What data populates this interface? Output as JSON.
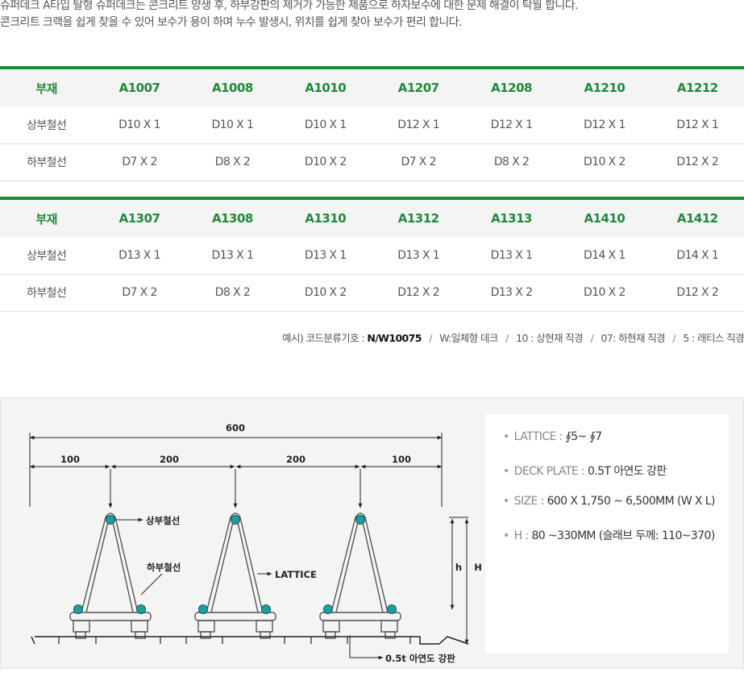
{
  "intro": {
    "line1": "슈퍼데크 A타입 탈형 슈퍼데크는 콘크리트 양생 후, 하부강판의 제거가 가능한 제품으로 하자보수에 대한 문제 해결이 탁월 합니다.",
    "line2": "콘크리트 크랙을 쉽게 찾을 수 있어 보수가 용이 하며 누수 발생시, 위치를 쉽게 찾아 보수가 편리 합니다."
  },
  "tables": [
    {
      "header": [
        "부재",
        "A1007",
        "A1008",
        "A1010",
        "A1207",
        "A1208",
        "A1210",
        "A1212"
      ],
      "rows": [
        [
          "상부철선",
          "D10 X 1",
          "D10 X 1",
          "D10 X 1",
          "D12 X 1",
          "D12 X 1",
          "D12 X 1",
          "D12 X 1"
        ],
        [
          "하부철선",
          "D7 X 2",
          "D8 X 2",
          "D10 X 2",
          "D7 X 2",
          "D8 X 2",
          "D10 X 2",
          "D12 X 2"
        ]
      ]
    },
    {
      "header": [
        "부재",
        "A1307",
        "A1308",
        "A1310",
        "A1312",
        "A1313",
        "A1410",
        "A1412"
      ],
      "rows": [
        [
          "상부철선",
          "D13 X 1",
          "D13 X 1",
          "D13 X 1",
          "D13 X 1",
          "D13 X 1",
          "D14 X 1",
          "D14 X 1"
        ],
        [
          "하부철선",
          "D7 X 2",
          "D8 X 2",
          "D10 X 2",
          "D12 X 2",
          "D13 X 2",
          "D10 X 2",
          "D12 X 2"
        ]
      ]
    }
  ],
  "code_note": {
    "prefix": "예시) 코드분류기호 :",
    "code": "N/W10075",
    "parts": [
      "W:일체형 데크",
      "10 : 상현재 직경",
      "07: 하현재 직경",
      "5 : 래티스 직경"
    ]
  },
  "diagram": {
    "total_width": "600",
    "segments": [
      "100",
      "200",
      "200",
      "100"
    ],
    "label_upper": "상부철선",
    "label_lower": "하부철선",
    "label_lattice": "LATTICE",
    "label_h": "h",
    "label_H": "H",
    "label_plate": "0.5t 아연도 강판",
    "accent_color": "#1aa0a0"
  },
  "specs": [
    {
      "label": "LATTICE :",
      "value": "∮5~ ∮7"
    },
    {
      "label": "DECK PLATE :",
      "value": "0.5T 아연도 강판"
    },
    {
      "label": "SIZE :",
      "value": "600 X 1,750 ~ 6,500MM (W X L)"
    },
    {
      "label": "H :",
      "value": "80 ~330MM (슬래브 두께: 110~370)"
    }
  ]
}
